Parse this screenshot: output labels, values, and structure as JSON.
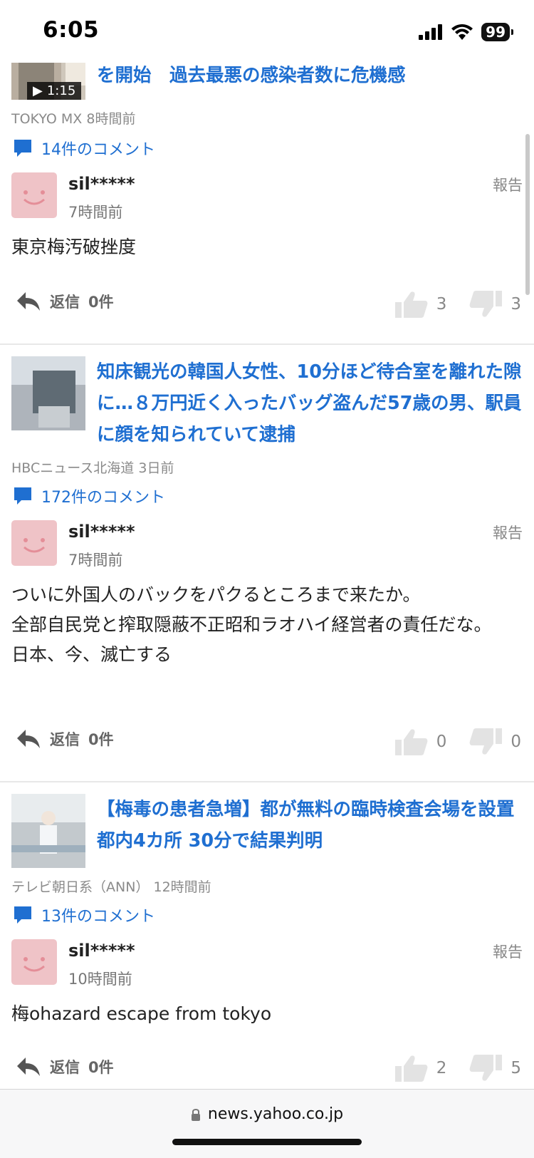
{
  "status_bar": {
    "time": "6:05",
    "battery": "99"
  },
  "url_bar": {
    "domain": "news.yahoo.co.jp"
  },
  "items": [
    {
      "headline": "を開始　過去最悪の感染者数に危機感",
      "video_duration": "1:15",
      "source": "TOKYO MX",
      "time_ago": "8時間前",
      "comments_link": "14件のコメント",
      "comment": {
        "user": "sil*****",
        "time": "7時間前",
        "report": "報告",
        "body": "東京梅汚破挫度",
        "reply": "返信",
        "reply_count": "0件",
        "likes": "3",
        "dislikes": "3"
      }
    },
    {
      "headline": "知床観光の韓国人女性、10分ほど待合室を離れた隙に…８万円近く入ったバッグ盗んだ57歳の男、駅員に顔を知られていて逮捕",
      "source": "HBCニュース北海道",
      "time_ago": "3日前",
      "comments_link": "172件のコメント",
      "comment": {
        "user": "sil*****",
        "time": "7時間前",
        "report": "報告",
        "body": "ついに外国人のバックをパクるところまで来たか。\n全部自民党と搾取隠蔽不正昭和ラオハイ経営者の責任だな。\n日本、今、滅亡する",
        "reply": "返信",
        "reply_count": "0件",
        "likes": "0",
        "dislikes": "0"
      }
    },
    {
      "headline": "【梅毒の患者急増】都が無料の臨時検査会場を設置　都内4カ所 30分で結果判明",
      "source": "テレビ朝日系（ANN）",
      "time_ago": "12時間前",
      "comments_link": "13件のコメント",
      "comment": {
        "user": "sil*****",
        "time": "10時間前",
        "report": "報告",
        "body": "梅ohazard escape from tokyo",
        "reply": "返信",
        "reply_count": "0件",
        "likes": "2",
        "dislikes": "5"
      }
    }
  ]
}
